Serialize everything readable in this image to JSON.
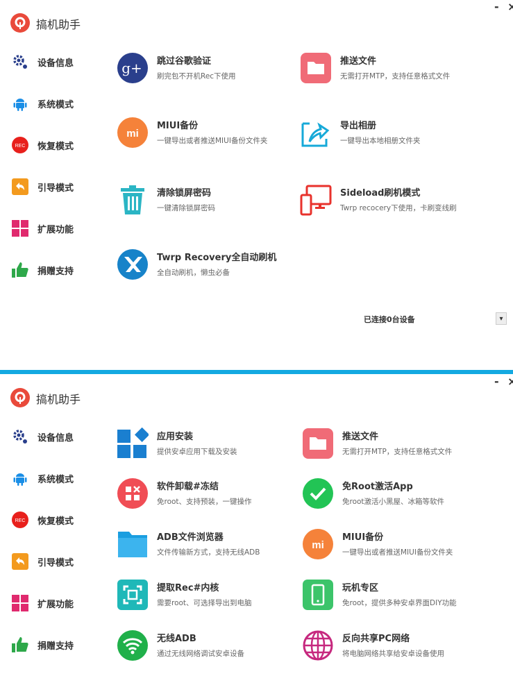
{
  "window": {
    "minimize": "-",
    "close": "×"
  },
  "app": {
    "title": "搞机助手"
  },
  "sidebar": {
    "items": [
      {
        "label": "设备信息",
        "icon": "gear-icon"
      },
      {
        "label": "系统模式",
        "icon": "android-icon"
      },
      {
        "label": "恢复模式",
        "icon": "rec-icon"
      },
      {
        "label": "引导模式",
        "icon": "back-arrow-icon"
      },
      {
        "label": "扩展功能",
        "icon": "tiles-icon"
      },
      {
        "label": "捐赠支持",
        "icon": "thumbs-up-icon"
      }
    ]
  },
  "panel1": {
    "features": [
      {
        "title": "跳过谷歌验证",
        "desc": "刷完包不开机Rec下使用",
        "icon": "google-plus-icon",
        "color": "#2a3f8c"
      },
      {
        "title": "推送文件",
        "desc": "无需打开MTP，支持任意格式文件",
        "icon": "folder-icon",
        "color": "#f06b77"
      },
      {
        "title": "MIUI备份",
        "desc": "一键导出或者推送MIUI备份文件夹",
        "icon": "mi-icon",
        "color": "#f5823a"
      },
      {
        "title": "导出相册",
        "desc": "一键导出本地相册文件夹",
        "icon": "export-icon",
        "color": "#16a9d8"
      },
      {
        "title": "清除锁屏密码",
        "desc": "一键清除锁屏密码",
        "icon": "trash-icon",
        "color": "#2bb5c4"
      },
      {
        "title": "Sideload刷机模式",
        "desc": "Twrp recocery下使用，卡刷变线刷",
        "icon": "devices-icon",
        "color": "#e8322c"
      },
      {
        "title": "Twrp Recovery全自动刷机",
        "desc": "全自动刷机，懒虫必备",
        "icon": "twrp-icon",
        "color": "#1783c9"
      }
    ],
    "status": "已连接0台设备",
    "dropdown": "▾"
  },
  "panel2": {
    "features": [
      {
        "title": "应用安装",
        "desc": "提供安卓应用下载及安装",
        "icon": "app-install-icon",
        "color": "#1a7fd0"
      },
      {
        "title": "推送文件",
        "desc": "无需打开MTP，支持任意格式文件",
        "icon": "folder-icon",
        "color": "#f06b77"
      },
      {
        "title": "软件卸载#冻结",
        "desc": "免root、支持预装，一键操作",
        "icon": "uninstall-icon",
        "color": "#f04d55"
      },
      {
        "title": "免Root激活App",
        "desc": "免root激活小黑屋、冰箱等软件",
        "icon": "check-icon",
        "color": "#22c455"
      },
      {
        "title": "ADB文件浏览器",
        "desc": "文件传输新方式，支持无线ADB",
        "icon": "folder-blue-icon",
        "color": "#1a9ee0"
      },
      {
        "title": "MIUI备份",
        "desc": "一键导出或者推送MIUI备份文件夹",
        "icon": "mi-icon",
        "color": "#f5823a"
      },
      {
        "title": "提取Rec#内核",
        "desc": "需要root、可选择导出到电脑",
        "icon": "scan-icon",
        "color": "#1fb8b8"
      },
      {
        "title": "玩机专区",
        "desc": "免root，提供多种安卓界面DIY功能",
        "icon": "phone-icon",
        "color": "#3cc46a"
      },
      {
        "title": "无线ADB",
        "desc": "通过无线网络调试安卓设备",
        "icon": "wifi-icon",
        "color": "#20b04a"
      },
      {
        "title": "反向共享PC网络",
        "desc": "将电脑网络共享给安卓设备使用",
        "icon": "globe-icon",
        "color": "#c6287e"
      }
    ]
  }
}
